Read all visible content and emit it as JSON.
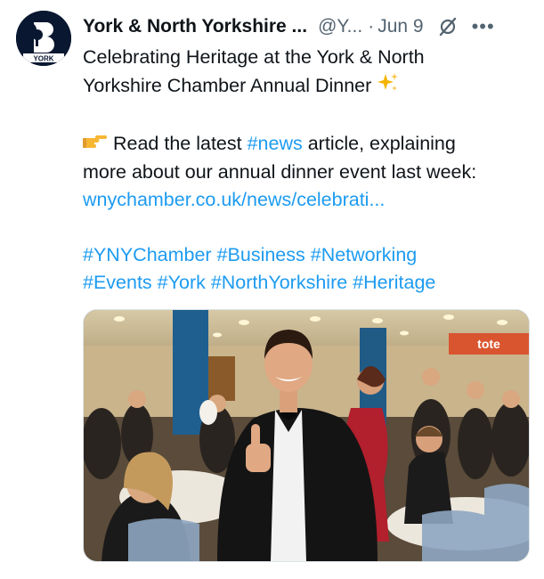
{
  "author": {
    "name": "York & North Yorkshire ...",
    "handle": "@Y...",
    "date": "Jun 9",
    "avatar_badge": "YORK"
  },
  "tweet": {
    "line1": "Celebrating Heritage at the York & North",
    "line2": "Yorkshire Chamber Annual Dinner",
    "line3_pre": "Read the latest ",
    "line3_tag": "#news",
    "line3_post": " article, explaining",
    "line4": "more about our annual dinner event last week:",
    "link": "wnychamber.co.uk/news/celebrati...",
    "hashtags_line1": "#YNYChamber #Business #Networking",
    "hashtags_line2": "#Events #York #NorthYorkshire #Heritage"
  },
  "photo": {
    "sign_text": "tote"
  },
  "icons": {
    "grok": "grok-slash-icon",
    "more": "more-dots-icon",
    "sparkles": "sparkles-icon",
    "pointing": "pointing-hand-icon"
  }
}
